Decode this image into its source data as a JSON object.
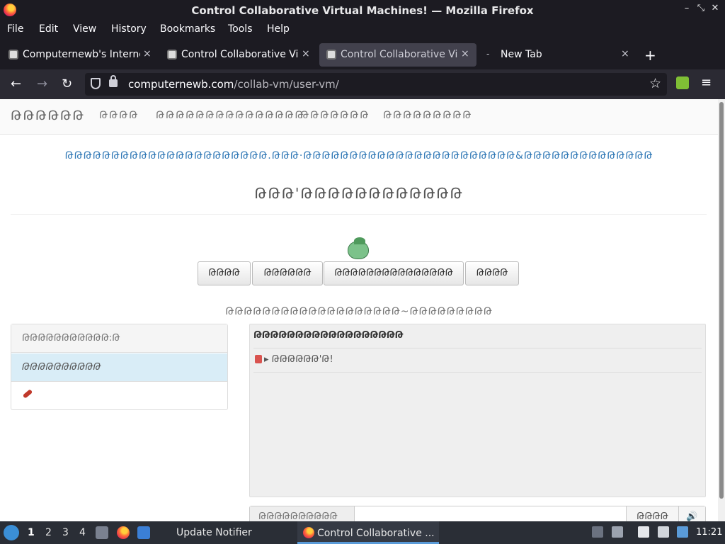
{
  "window": {
    "title": "Control Collaborative Virtual Machines! — Mozilla Firefox",
    "controls": [
      "–",
      "⤡",
      "✕"
    ]
  },
  "menu": [
    "File",
    "Edit",
    "View",
    "History",
    "Bookmarks",
    "Tools",
    "Help"
  ],
  "tabs": [
    {
      "label": "Computernewb's Internet",
      "close": "×",
      "active": false
    },
    {
      "label": "Control Collaborative Virt",
      "close": "×",
      "active": false
    },
    {
      "label": "Control Collaborative Virt",
      "close": "×",
      "active": true
    },
    {
      "label": "New Tab",
      "close": "×",
      "active": false
    }
  ],
  "new_tab_plus": "+",
  "nav": {
    "back": "←",
    "forward": "→",
    "reload": "↻",
    "url_host": "computernewb.com",
    "url_path": "/collab-vm/user-vm/",
    "bookmark": "☆",
    "menu": "≡"
  },
  "page": {
    "site_nav": [
      "ԹԹԹԹԹԹ",
      "ԹԹԹԹ",
      "ԹԹԹԹԹԹԹԹԹԹԹԹԹԹԹ",
      "ԹԹԹԹԹԹԹ",
      "ԹԹԹԹԹԹԹԹԹ"
    ],
    "tagline": "ԹԹԹԹԹԹԹԹԹԹԹԹԹԹԹԹԹԹԹԹԹԹ.ԹԹԹ·ԹԹԹԹԹԹԹԹԹԹԹԹԹԹԹԹԹԹԹԹԹԹԹ&ԹԹԹԹԹԹԹԹԹԹԹԹԹԹ",
    "headline": "ԹԹԹ'ԹԹԹԹԹԹԹԹԹԹԹԹ",
    "buttons": [
      "ԹԹԹԹ",
      "ԹԹԹԹԹԹ",
      "ԹԹԹԹԹԹԹԹԹԹԹԹԹԹԹ",
      "ԹԹԹԹ"
    ],
    "vm_title": "ԹԹԹԹԹԹԹԹԹԹԹԹԹԹԹԹԹԹԹ~ԹԹԹԹԹԹԹԹԹ",
    "users_header": "ԹԹԹԹԹԹԹԹԹԹԹ:Թ",
    "user_row": "ԹԹԹԹԹԹԹԹԹԹ",
    "chat_header": "ԹԹԹԹԹԹԹԹԹԹԹԹԹԹԹԹԹԹ",
    "chat_message": "ԹԹԹԹԹԹ'Թ!",
    "chat_arrow": "▸",
    "chat_username": "ԹԹԹԹԹԹԹԹԹԹ",
    "send_label": "ԹԹԹԹ",
    "volume_icon": "🔊"
  },
  "taskbar": {
    "workspaces": [
      "1",
      "2",
      "3",
      "4"
    ],
    "tasks": [
      "Update Notifier",
      "Control Collaborative ..."
    ],
    "clock": "11:21"
  }
}
